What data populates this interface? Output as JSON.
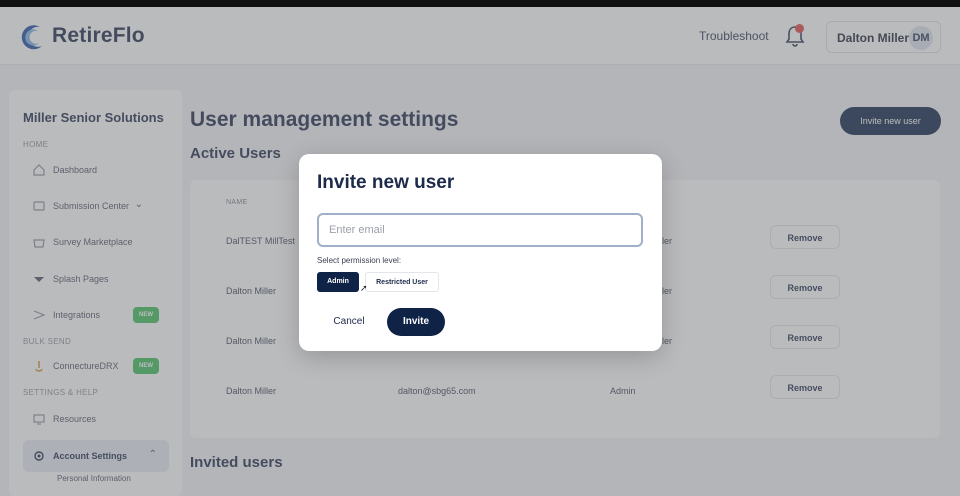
{
  "app": {
    "brand": "RetireFlo"
  },
  "header": {
    "troubleshoot": "Troubleshoot",
    "user_name": "Dalton Miller",
    "user_initials": "DM"
  },
  "sidebar": {
    "org": "Miller Senior Solutions",
    "sections": {
      "home": "HOME",
      "bulk_send": "BULK SEND",
      "settings_help": "SETTINGS & HELP"
    },
    "items": [
      {
        "label": "Dashboard"
      },
      {
        "label": "Submission Center"
      },
      {
        "label": "Survey Marketplace"
      },
      {
        "label": "Splash Pages"
      },
      {
        "label": "Integrations",
        "badge": "NEW"
      },
      {
        "label": "ConnectureDRX",
        "badge": "NEW"
      },
      {
        "label": "Resources"
      },
      {
        "label": "Account Settings"
      }
    ],
    "subitem": "Personal Information"
  },
  "main": {
    "title": "User management settings",
    "invite_button": "Invite new user",
    "active_users_title": "Active Users",
    "name_header": "NAME",
    "rows": [
      {
        "name": "DalTEST MillTest",
        "email": "",
        "role": "ller",
        "action": "Remove"
      },
      {
        "name": "Dalton Miller",
        "email": "",
        "role": "ller",
        "action": "Remove"
      },
      {
        "name": "Dalton Miller",
        "email": "",
        "role": "ller",
        "action": "Remove"
      },
      {
        "name": "Dalton Miller",
        "email": "dalton@sbg65.com",
        "role": "Admin",
        "action": "Remove"
      }
    ],
    "invited_users_title": "Invited users"
  },
  "modal": {
    "title": "Invite new user",
    "email_placeholder": "Enter email",
    "email_value": "",
    "permission_label": "Select permission level:",
    "options": [
      "Admin",
      "Restricted User"
    ],
    "selected_option": "Admin",
    "cancel": "Cancel",
    "invite": "Invite"
  },
  "colors": {
    "primary": "#0f2347",
    "new_badge": "#3fbf5b",
    "notification": "#e04545"
  },
  "icons": [
    "retireflo-logo-icon",
    "bell-icon",
    "dashboard-icon",
    "submission-icon",
    "marketplace-icon",
    "splash-icon",
    "integrations-icon",
    "connecture-icon",
    "resources-icon",
    "settings-gear-icon",
    "chevron-down-icon",
    "chevron-up-icon",
    "cursor-icon"
  ]
}
